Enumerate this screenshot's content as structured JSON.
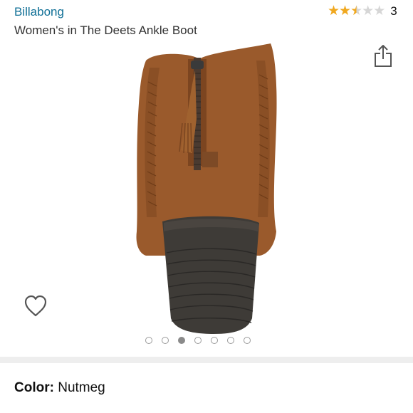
{
  "product": {
    "brand": "Billabong",
    "title": "Women's in The Deets Ankle Boot",
    "rating": {
      "stars": 2.5,
      "max": 5,
      "count": "3"
    }
  },
  "gallery": {
    "image_count": 7,
    "active_index": 2
  },
  "color": {
    "label": "Color:",
    "value": "Nutmeg"
  },
  "colors": {
    "brand_link": "#0f6f96",
    "star_fill": "#f0a81f",
    "star_empty": "#d6d6d6",
    "boot_suede": "#9a5a2c",
    "heel": "#3e3b37"
  },
  "icons": {
    "share": "share-icon",
    "wishlist": "heart-outline-icon",
    "star": "star-icon"
  }
}
